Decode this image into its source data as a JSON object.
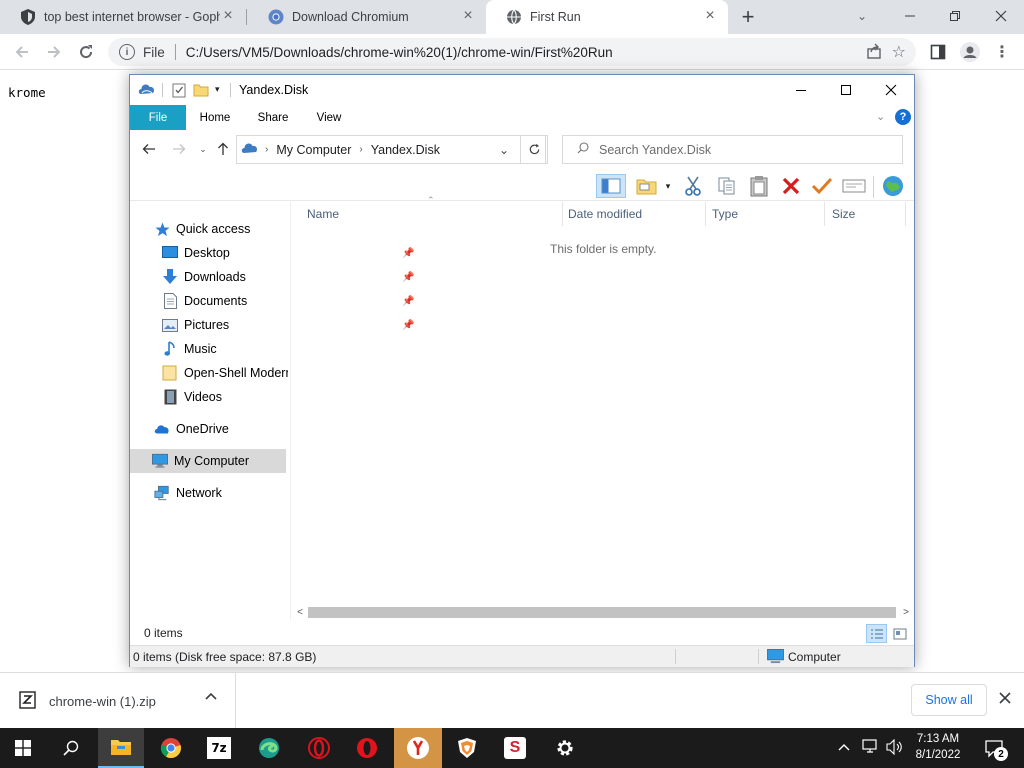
{
  "browser": {
    "tabs": [
      {
        "title": "top best internet browser - Goph",
        "icon": "shield-icon"
      },
      {
        "title": "Download Chromium",
        "icon": "chromium-icon"
      },
      {
        "title": "First Run",
        "icon": "globe-icon",
        "active": true
      }
    ],
    "address": {
      "chip": "File",
      "url": "C:/Users/VM5/Downloads/chrome-win%20(1)/chrome-win/First%20Run"
    }
  },
  "page": {
    "text": "krome"
  },
  "explorer": {
    "title": "Yandex.Disk",
    "ribbon_tabs": [
      "File",
      "Home",
      "Share",
      "View"
    ],
    "breadcrumb": [
      "My Computer",
      "Yandex.Disk"
    ],
    "search_placeholder": "Search Yandex.Disk",
    "nav": {
      "quick_access": "Quick access",
      "items": [
        {
          "label": "Desktop",
          "pinned": true
        },
        {
          "label": "Downloads",
          "pinned": true
        },
        {
          "label": "Documents",
          "pinned": true
        },
        {
          "label": "Pictures",
          "pinned": true
        },
        {
          "label": "Music"
        },
        {
          "label": "Open-Shell Modern"
        },
        {
          "label": "Videos"
        }
      ],
      "onedrive": "OneDrive",
      "my_computer": "My Computer",
      "network": "Network"
    },
    "columns": [
      "Name",
      "Date modified",
      "Type",
      "Size"
    ],
    "empty_message": "This folder is empty.",
    "item_count": "0 items",
    "status_left": "0 items (Disk free space: 87.8 GB)",
    "status_right": "Computer"
  },
  "download_bar": {
    "filename": "chrome-win (1).zip",
    "show_all": "Show all"
  },
  "taskbar": {
    "time": "7:13 AM",
    "date": "8/1/2022",
    "notification_count": "2"
  }
}
